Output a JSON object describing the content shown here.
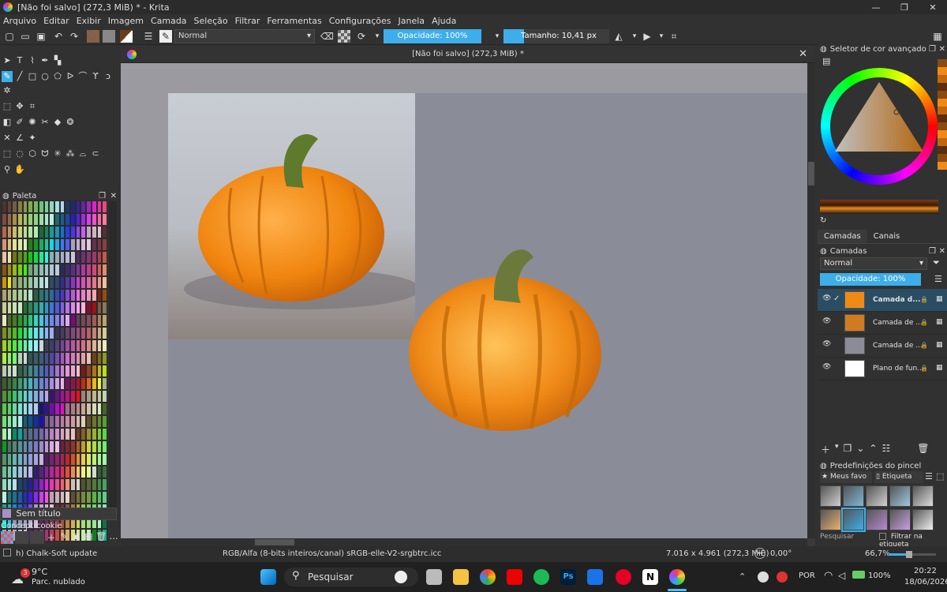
{
  "window": {
    "title": "[Não foi salvo]  (272,3 MiB) * - Krita",
    "minimize": "—",
    "maximize": "❐",
    "close": "✕"
  },
  "menu": [
    "Arquivo",
    "Editar",
    "Exibir",
    "Imagem",
    "Camada",
    "Seleção",
    "Filtrar",
    "Ferramentas",
    "Configurações",
    "Janela",
    "Ajuda"
  ],
  "toolbar": {
    "blend_mode": "Normal",
    "opacity_label": "Opacidade: 100%",
    "opacity_value": 1.0,
    "size_label": "Tamanho: 10,41 px"
  },
  "document": {
    "tab_title": "[Não foi salvo]  (272,3 MiB) *"
  },
  "palette": {
    "title": "Paleta",
    "current_name": "Sem título",
    "palette_name": "Concept-cookie"
  },
  "color_selector": {
    "title": "Seletor de cor avançado"
  },
  "layers": {
    "tabs": [
      "Camadas",
      "Canais"
    ],
    "title": "Camadas",
    "blend_mode": "Normal",
    "opacity_label": "Opacidade: 100%",
    "items": [
      {
        "name": "Camada d...",
        "active": true
      },
      {
        "name": "Camada de ...",
        "active": false
      },
      {
        "name": "Camada de ...",
        "active": false
      },
      {
        "name": "Plano de fun...",
        "active": false
      }
    ]
  },
  "brush_presets": {
    "title": "Predefinições do pincel",
    "filter_label": "Meus favo",
    "tag_label": "Etiqueta",
    "search_placeholder": "Pesquisar",
    "filter_in_tag": "Filtrar na etiqueta"
  },
  "statusbar": {
    "brush_name": "h) Chalk-Soft update",
    "color_space": "RGB/Alfa (8-bits inteiros/canal)  sRGB-elle-V2-srgbtrc.icc",
    "dimensions": "7.016 x 4.961 (272,3 MiB)",
    "rotation": "0,00°",
    "zoom": "66,7%"
  },
  "taskbar": {
    "weather_temp": "9°C",
    "weather_desc": "Parc. nublado",
    "weather_badge": "3",
    "search_placeholder": "Pesquisar",
    "language": "POR",
    "battery": "100%",
    "time": "20:22",
    "date": "18/06/2026"
  },
  "colors": {
    "accent": "#3daee9",
    "pumpkin": "#f08a17",
    "stem": "#6b7a3a"
  }
}
